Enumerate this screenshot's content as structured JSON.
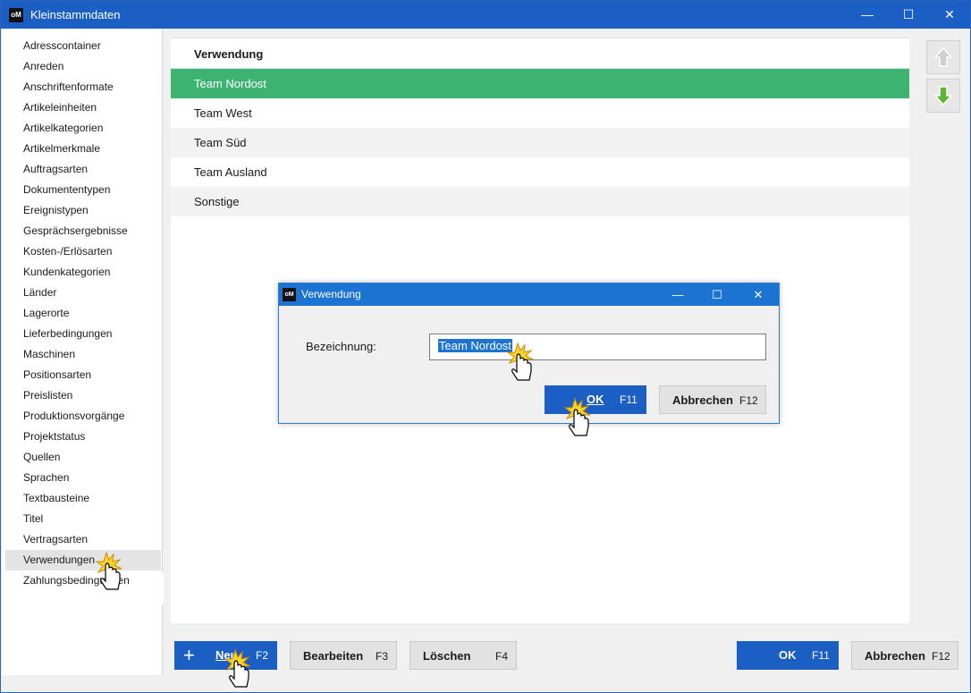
{
  "window": {
    "title": "Kleinstammdaten",
    "app_icon_text": "oM",
    "controls": {
      "minimize": "—",
      "maximize": "☐",
      "close": "✕"
    }
  },
  "sidebar": {
    "items": [
      {
        "label": "Adresscontainer"
      },
      {
        "label": "Anreden"
      },
      {
        "label": "Anschriftenformate"
      },
      {
        "label": "Artikeleinheiten"
      },
      {
        "label": "Artikelkategorien"
      },
      {
        "label": "Artikelmerkmale"
      },
      {
        "label": "Auftragsarten"
      },
      {
        "label": "Dokumententypen"
      },
      {
        "label": "Ereignistypen"
      },
      {
        "label": "Gesprächsergebnisse"
      },
      {
        "label": "Kosten-/Erlösarten"
      },
      {
        "label": "Kundenkategorien"
      },
      {
        "label": "Länder"
      },
      {
        "label": "Lagerorte"
      },
      {
        "label": "Lieferbedingungen"
      },
      {
        "label": "Maschinen"
      },
      {
        "label": "Positionsarten"
      },
      {
        "label": "Preislisten"
      },
      {
        "label": "Produktionsvorgänge"
      },
      {
        "label": "Projektstatus"
      },
      {
        "label": "Quellen"
      },
      {
        "label": "Sprachen"
      },
      {
        "label": "Textbausteine"
      },
      {
        "label": "Titel"
      },
      {
        "label": "Vertragsarten"
      },
      {
        "label": "Verwendungen"
      },
      {
        "label": "Zahlungsbedingungen"
      }
    ],
    "selected": "Verwendungen"
  },
  "list": {
    "header": "Verwendung",
    "rows": [
      {
        "label": "Team Nordost"
      },
      {
        "label": "Team West"
      },
      {
        "label": "Team Süd"
      },
      {
        "label": "Team Ausland"
      },
      {
        "label": "Sonstige"
      }
    ],
    "selected": "Team Nordost"
  },
  "side_buttons": {
    "up_icon": "arrow-up-icon",
    "down_icon": "arrow-down-icon"
  },
  "footer": {
    "new": {
      "label": "Neu",
      "key": "F2",
      "icon": "+"
    },
    "edit": {
      "label": "Bearbeiten",
      "key": "F3"
    },
    "delete": {
      "label": "Löschen",
      "key": "F4"
    },
    "ok": {
      "label": "OK",
      "key": "F11"
    },
    "cancel": {
      "label": "Abbrechen",
      "key": "F12"
    }
  },
  "dialog": {
    "title": "Verwendung",
    "app_icon_text": "oM",
    "controls": {
      "minimize": "—",
      "maximize": "☐",
      "close": "✕"
    },
    "field_label": "Bezeichnung:",
    "field_value": "Team Nordost",
    "ok": {
      "label": "OK",
      "key": "F11"
    },
    "cancel": {
      "label": "Abbrechen",
      "key": "F12"
    }
  },
  "colors": {
    "titlebar": "#1c5fc4",
    "selected_row": "#3cb371",
    "primary_button": "#1c5fc4",
    "dialog_titlebar": "#1c73d2"
  }
}
